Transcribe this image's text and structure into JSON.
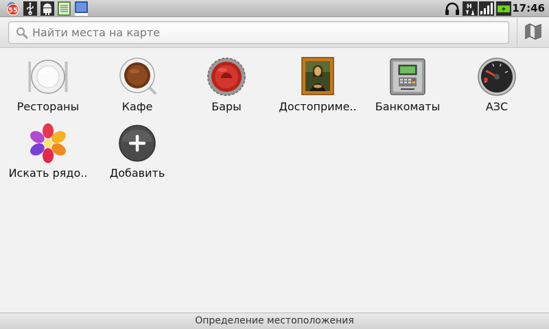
{
  "status_bar": {
    "time": "17:46",
    "notification_count": "55",
    "left_icons": [
      "notification-55-icon",
      "usb-icon",
      "android-debug-icon",
      "document-icon",
      "book-icon"
    ],
    "right_icons": [
      "headphones-icon",
      "data-transfer-icon",
      "signal-icon",
      "battery-charging-icon"
    ],
    "battery_color": "#6fd21a"
  },
  "search": {
    "placeholder": "Найти места на карте",
    "value": ""
  },
  "categories": [
    {
      "label": "Рестораны",
      "icon": "restaurant-plate-icon"
    },
    {
      "label": "Кафе",
      "icon": "coffee-cup-icon"
    },
    {
      "label": "Бары",
      "icon": "bottle-cap-icon"
    },
    {
      "label": "Достоприме..",
      "icon": "mona-lisa-painting-icon"
    },
    {
      "label": "Банкоматы",
      "icon": "atm-icon"
    },
    {
      "label": "АЗС",
      "icon": "fuel-gauge-icon"
    },
    {
      "label": "Искать рядо..",
      "icon": "flower-search-icon"
    },
    {
      "label": "Добавить",
      "icon": "add-plus-icon"
    }
  ],
  "bottom_bar": {
    "status": "Определение местоположения"
  }
}
